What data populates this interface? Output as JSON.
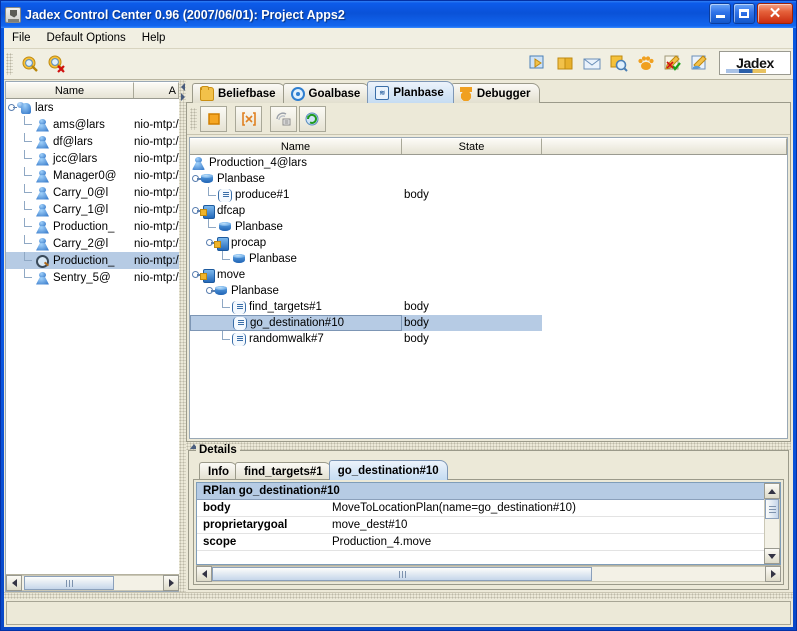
{
  "window": {
    "title": "Jadex Control Center 0.96 (2007/06/01): Project Apps2",
    "icon": "java-cup-icon",
    "buttons": {
      "minimize": "minimize-button",
      "maximize": "maximize-button",
      "close": "close-button"
    }
  },
  "menubar": {
    "items": [
      "File",
      "Default Options",
      "Help"
    ]
  },
  "toolbar": {
    "left_buttons": [
      {
        "name": "start-agent-magnifier-icon",
        "tooltip": "Start Agent"
      },
      {
        "name": "kill-agent-magnifier-icon",
        "tooltip": "Kill Agent"
      }
    ],
    "right_buttons": [
      {
        "name": "starter-icon"
      },
      {
        "name": "library-book-icon"
      },
      {
        "name": "message-envelope-icon"
      },
      {
        "name": "introspector-magnifier-icon"
      },
      {
        "name": "awareness-paw-icon"
      },
      {
        "name": "testcenter-pencil-icon"
      },
      {
        "name": "editor-pencil-icon"
      }
    ],
    "logo_text": "Jadex"
  },
  "agent_tree": {
    "columns": [
      "Name",
      "A"
    ],
    "rows": [
      {
        "indent": 0,
        "label": "lars",
        "address": "",
        "icon": "agents-group-icon",
        "expanded": true,
        "selected": false
      },
      {
        "indent": 1,
        "label": "ams@lars",
        "address": "nio-mtp:/",
        "icon": "agent-icon",
        "selected": false
      },
      {
        "indent": 1,
        "label": "df@lars",
        "address": "nio-mtp:/",
        "icon": "agent-icon",
        "selected": false
      },
      {
        "indent": 1,
        "label": "jcc@lars",
        "address": "nio-mtp:/",
        "icon": "agent-icon",
        "selected": false
      },
      {
        "indent": 1,
        "label": "Manager0@",
        "address": "nio-mtp:/",
        "icon": "agent-icon",
        "selected": false
      },
      {
        "indent": 1,
        "label": "Carry_0@l",
        "address": "nio-mtp:/",
        "icon": "agent-icon",
        "selected": false
      },
      {
        "indent": 1,
        "label": "Carry_1@l",
        "address": "nio-mtp:/",
        "icon": "agent-icon",
        "selected": false
      },
      {
        "indent": 1,
        "label": "Production_",
        "address": "nio-mtp:/",
        "icon": "agent-icon",
        "selected": false
      },
      {
        "indent": 1,
        "label": "Carry_2@l",
        "address": "nio-mtp:/",
        "icon": "agent-icon",
        "selected": false
      },
      {
        "indent": 1,
        "label": "Production_",
        "address": "nio-mtp:/",
        "icon": "agent-magnifier-icon",
        "selected": true
      },
      {
        "indent": 1,
        "label": "Sentry_5@",
        "address": "nio-mtp:/",
        "icon": "agent-icon",
        "selected": false
      }
    ]
  },
  "tabs": [
    {
      "label": "Beliefbase",
      "icon": "folder-icon",
      "active": false
    },
    {
      "label": "Goalbase",
      "icon": "circle-icon",
      "active": false
    },
    {
      "label": "Planbase",
      "icon": "plan-icon",
      "active": true
    },
    {
      "label": "Debugger",
      "icon": "paw-icon",
      "active": false
    }
  ],
  "plan_toolbar": [
    {
      "name": "stop-square-button"
    },
    {
      "name": "step-brackets-button"
    },
    {
      "name": "trace-button"
    },
    {
      "name": "refresh-button"
    }
  ],
  "plan_tree": {
    "columns": [
      "Name",
      "State"
    ],
    "rows": [
      {
        "indent": 0,
        "label": "Production_4@lars",
        "state": "",
        "icon": "agent-icon",
        "expanded": false,
        "selected": false
      },
      {
        "indent": 1,
        "label": "Planbase",
        "state": "",
        "icon": "planbase-icon",
        "expanded": true,
        "selected": false
      },
      {
        "indent": 2,
        "label": "produce#1",
        "state": "body",
        "icon": "plan-icon",
        "selected": false
      },
      {
        "indent": 1,
        "label": "dfcap",
        "state": "",
        "icon": "capability-icon",
        "expanded": true,
        "selected": false
      },
      {
        "indent": 2,
        "label": "Planbase",
        "state": "",
        "icon": "planbase-icon",
        "selected": false
      },
      {
        "indent": 2,
        "label": "procap",
        "state": "",
        "icon": "capability-icon",
        "expanded": true,
        "selected": false
      },
      {
        "indent": 3,
        "label": "Planbase",
        "state": "",
        "icon": "planbase-icon",
        "selected": false
      },
      {
        "indent": 1,
        "label": "move",
        "state": "",
        "icon": "capability-icon",
        "expanded": true,
        "selected": false
      },
      {
        "indent": 2,
        "label": "Planbase",
        "state": "",
        "icon": "planbase-icon",
        "expanded": true,
        "selected": false
      },
      {
        "indent": 3,
        "label": "find_targets#1",
        "state": "body",
        "icon": "plan-icon",
        "selected": false
      },
      {
        "indent": 3,
        "label": "go_destination#10",
        "state": "body",
        "icon": "plan-icon",
        "selected": true
      },
      {
        "indent": 3,
        "label": "randomwalk#7",
        "state": "body",
        "icon": "plan-icon",
        "selected": false
      }
    ]
  },
  "details": {
    "legend": "Details",
    "tabs": [
      {
        "label": "Info",
        "active": false
      },
      {
        "label": "find_targets#1",
        "active": false
      },
      {
        "label": "go_destination#10",
        "active": true
      }
    ],
    "header": "RPlan go_destination#10",
    "properties": [
      {
        "key": "body",
        "value": "MoveToLocationPlan(name=go_destination#10)"
      },
      {
        "key": "proprietarygoal",
        "value": "move_dest#10"
      },
      {
        "key": "scope",
        "value": "Production_4.move"
      }
    ]
  },
  "colors": {
    "title_blue": "#0a5ae8",
    "selection": "#b6cbe4",
    "active_tab": "#c5dcf2",
    "panel": "#ece9d8"
  }
}
